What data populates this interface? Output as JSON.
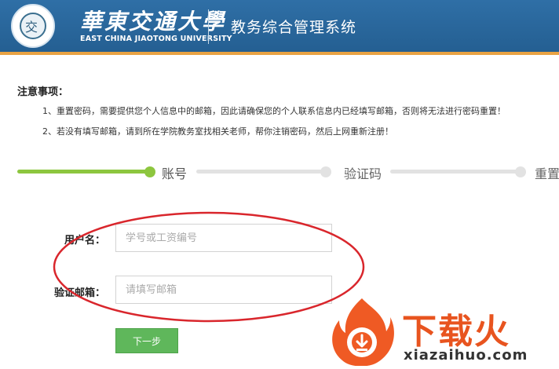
{
  "header": {
    "seal_glyph": "交",
    "university_cn": "華東交通大學",
    "university_en": "EAST CHINA JIAOTONG UNIVERSITY",
    "system_title": "教务综合管理系统",
    "bg_color": "#2a6a9f",
    "accent_line_color": "#e9a343"
  },
  "notice": {
    "title": "注意事项：",
    "items": [
      "1、重置密码，需要提供您个人信息中的邮箱，因此请确保您的个人联系信息内已经填写邮箱，否则将无法进行密码重置！",
      "2、若没有填写邮箱，请到所在学院教务室找相关老师，帮你注销密码，然后上网重新注册！"
    ]
  },
  "steps": {
    "items": [
      {
        "label": "账号",
        "active": true
      },
      {
        "label": "验证码",
        "active": false
      },
      {
        "label": "重置",
        "active": false
      }
    ],
    "active_color": "#8dc63f",
    "inactive_color": "#e2e2e2"
  },
  "form": {
    "username_label": "用户名：",
    "username_placeholder": "学号或工资编号",
    "username_value": "",
    "email_label": "验证邮箱：",
    "email_placeholder": "请填写邮箱",
    "email_value": "",
    "next_button": "下一步",
    "button_color": "#5fb75b"
  },
  "annotation": {
    "ellipse_color": "#d9262c"
  },
  "watermark": {
    "text": "下载火",
    "domain": "xiazaihuo.com",
    "color": "#e8541f"
  }
}
